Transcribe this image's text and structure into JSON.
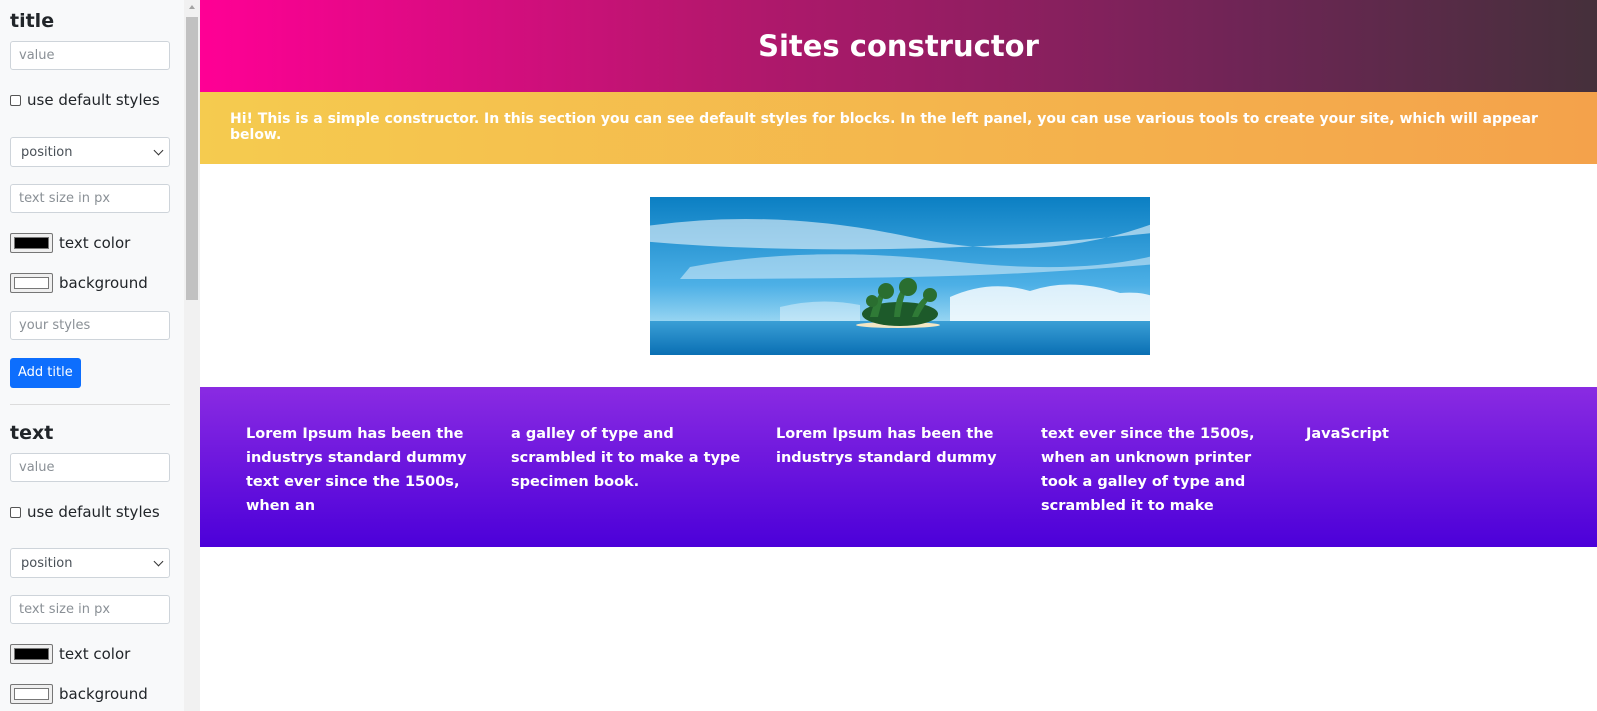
{
  "sidebar": {
    "sections": [
      {
        "title": "title",
        "value_placeholder": "value",
        "default_styles_label": "use default styles",
        "position_label": "position",
        "text_size_placeholder": "text size in px",
        "text_color_label": "text color",
        "background_label": "background",
        "styles_placeholder": "your styles",
        "add_button_label": "Add title"
      },
      {
        "title": "text",
        "value_placeholder": "value",
        "default_styles_label": "use default styles",
        "position_label": "position",
        "text_size_placeholder": "text size in px",
        "text_color_label": "text color",
        "background_label": "background"
      }
    ],
    "colors": {
      "text_color_swatch": "#000000",
      "background_swatch": "#ffffff",
      "add_button": "#0d6efd"
    }
  },
  "main": {
    "header": {
      "title": "Sites constructor"
    },
    "intro": {
      "text": "Hi! This is a simple constructor. In this section you can see default styles for blocks. In the left panel, you can use various tools to create your site, which will appear below."
    },
    "image": {
      "icon": "tropical-island-image"
    },
    "columns": [
      "Lorem Ipsum has been the industrys standard dummy text ever since the 1500s, when an",
      "a galley of type and scrambled it to make a type specimen book.",
      "Lorem Ipsum has been the industrys standard dummy",
      "text ever since the 1500s, when an unknown printer took a galley of type and scrambled it to make",
      "JavaScript"
    ]
  }
}
